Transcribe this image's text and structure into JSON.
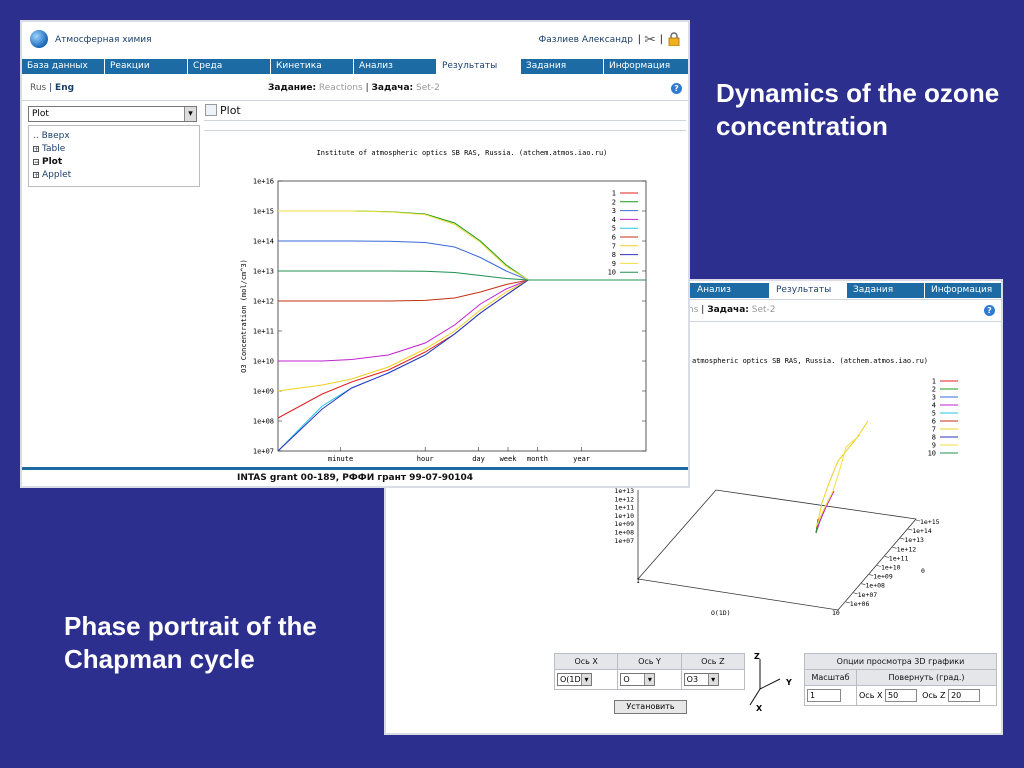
{
  "captions": {
    "top": "Dynamics of the ozone concentration",
    "bottom": "Phase portrait of the Chapman cycle"
  },
  "front": {
    "app_title": "Атмосферная химия",
    "user_name": "Фазлиев Александр",
    "separator": "|",
    "tabs": [
      "База данных",
      "Реакции",
      "Среда",
      "Кинетика",
      "Анализ",
      "Результаты",
      "Задания",
      "Информация"
    ],
    "active_tab": "Результаты",
    "lang": {
      "rus": "Rus",
      "sep": "|",
      "eng": "Eng"
    },
    "task": {
      "label1": "Задание:",
      "value1": "Reactions",
      "sep": "|",
      "label2": "Задача:",
      "value2": "Set-2"
    },
    "help": "?",
    "dropdown_value": "Plot",
    "tree": [
      {
        "prefix": "..",
        "label": "Вверх",
        "box": ""
      },
      {
        "prefix": "",
        "label": "Table",
        "box": "+"
      },
      {
        "prefix": "",
        "label": "Plot",
        "box": "−"
      },
      {
        "prefix": "",
        "label": "Applet",
        "box": "+"
      }
    ],
    "plot_heading": "Plot",
    "footer": "INTAS grant 00-189, РФФИ грант 99-07-90104"
  },
  "back": {
    "tabs": [
      "Анализ",
      "Результаты",
      "Задания",
      "Информация"
    ],
    "active_tab": "Результаты",
    "task": {
      "value1_partial": "ns",
      "sep": "|",
      "label2": "Задача:",
      "value2": "Set-2"
    },
    "help": "?",
    "axis_table": {
      "headers": [
        "Ось X",
        "Ось Y",
        "Ось Z"
      ],
      "values": [
        "O(1D)",
        "O",
        "O3"
      ]
    },
    "options_table": {
      "title": "Опции просмотра 3D графики",
      "headers": [
        "Масштаб",
        "Повернуть (град.)"
      ],
      "scale": "1",
      "rot_x_label": "Ось X",
      "rot_x": "50",
      "rot_z_label": "Ось Z",
      "rot_z": "20"
    },
    "axes_icon": {
      "z": "Z",
      "y": "Y",
      "x": "X"
    },
    "button": "Установить"
  },
  "chart_data": [
    {
      "type": "line",
      "title": "Institute of atmospheric optics SB RAS, Russia. (atchem.atmos.iao.ru)",
      "xlabel": "Time",
      "ylabel": "O3 Concentration (mol/cm^3)",
      "yscale": "log",
      "ylim": [
        10000000.0,
        1e+16
      ],
      "y_ticks": [
        "1e+07",
        "1e+08",
        "1e+09",
        "1e+10",
        "1e+11",
        "1e+12",
        "1e+13",
        "1e+14",
        "1e+15",
        "1e+16"
      ],
      "x_ticks": [
        "minute",
        "hour",
        "day",
        "week",
        "month",
        "year"
      ],
      "legend_position": "top-right",
      "x_rel": [
        0,
        0.12,
        0.2,
        0.3,
        0.4,
        0.48,
        0.55,
        0.62,
        0.68,
        1.0
      ],
      "series": [
        {
          "name": "1",
          "color": "#e02020",
          "log10_values": [
            8.1,
            8.9,
            9.3,
            9.7,
            10.3,
            10.9,
            11.6,
            12.2,
            12.7,
            12.7
          ]
        },
        {
          "name": "2",
          "color": "#1a9a1a",
          "log10_values": [
            15.0,
            15.0,
            15.0,
            14.98,
            14.9,
            14.6,
            14.0,
            13.2,
            12.7,
            12.7
          ]
        },
        {
          "name": "3",
          "color": "#3a6ad8",
          "log10_values": [
            14.0,
            14.0,
            14.0,
            13.99,
            13.95,
            13.8,
            13.45,
            13.0,
            12.7,
            12.7
          ]
        },
        {
          "name": "4",
          "color": "#c020d0",
          "log10_values": [
            10.0,
            10.0,
            10.05,
            10.2,
            10.6,
            11.2,
            11.9,
            12.4,
            12.7,
            12.7
          ]
        },
        {
          "name": "5",
          "color": "#20c8e0",
          "log10_values": [
            7.0,
            8.5,
            9.1,
            9.6,
            10.2,
            10.9,
            11.6,
            12.2,
            12.7,
            12.7
          ]
        },
        {
          "name": "6",
          "color": "#c03010",
          "log10_values": [
            12.0,
            12.0,
            12.0,
            12.0,
            12.02,
            12.1,
            12.3,
            12.55,
            12.7,
            12.7
          ]
        },
        {
          "name": "7",
          "color": "#f0d020",
          "log10_values": [
            9.0,
            9.2,
            9.4,
            9.8,
            10.4,
            11.0,
            11.7,
            12.3,
            12.7,
            12.7
          ]
        },
        {
          "name": "8",
          "color": "#3030c0",
          "log10_values": [
            7.0,
            8.4,
            9.1,
            9.6,
            10.2,
            10.9,
            11.6,
            12.2,
            12.7,
            12.7
          ]
        },
        {
          "name": "9",
          "color": "#f0e040",
          "log10_values": [
            15.0,
            15.0,
            15.0,
            14.97,
            14.88,
            14.55,
            13.95,
            13.15,
            12.7,
            12.7
          ]
        },
        {
          "name": "10",
          "color": "#209050",
          "log10_values": [
            13.0,
            13.0,
            13.0,
            13.0,
            12.99,
            12.95,
            12.85,
            12.75,
            12.7,
            12.7
          ]
        }
      ]
    },
    {
      "type": "line",
      "title": "atmospheric optics SB RAS, Russia. (atchem.atmos.iao.ru)",
      "xlabel": "O(1D)",
      "z_ticks": [
        "1e+13",
        "1e+12",
        "1e+11",
        "1e+10",
        "1e+09",
        "1e+08",
        "1e+07"
      ],
      "y_ticks": [
        "1e+15",
        "1e+14",
        "1e+13",
        "1e+12",
        "1e+11",
        "1e+10",
        "1e+09",
        "1e+08",
        "1e+07",
        "1e+06"
      ],
      "x_ticks": [
        "1",
        "10"
      ],
      "extra_label": "0",
      "legend_position": "top-right",
      "series": [
        {
          "name": "1",
          "color": "#e02020"
        },
        {
          "name": "2",
          "color": "#1a9a1a"
        },
        {
          "name": "3",
          "color": "#3a6ad8"
        },
        {
          "name": "4",
          "color": "#c020d0"
        },
        {
          "name": "5",
          "color": "#20c8e0"
        },
        {
          "name": "6",
          "color": "#c03010"
        },
        {
          "name": "7",
          "color": "#f0d020"
        },
        {
          "name": "8",
          "color": "#3030c0"
        },
        {
          "name": "9",
          "color": "#f0e040"
        },
        {
          "name": "10",
          "color": "#209050"
        }
      ]
    }
  ]
}
